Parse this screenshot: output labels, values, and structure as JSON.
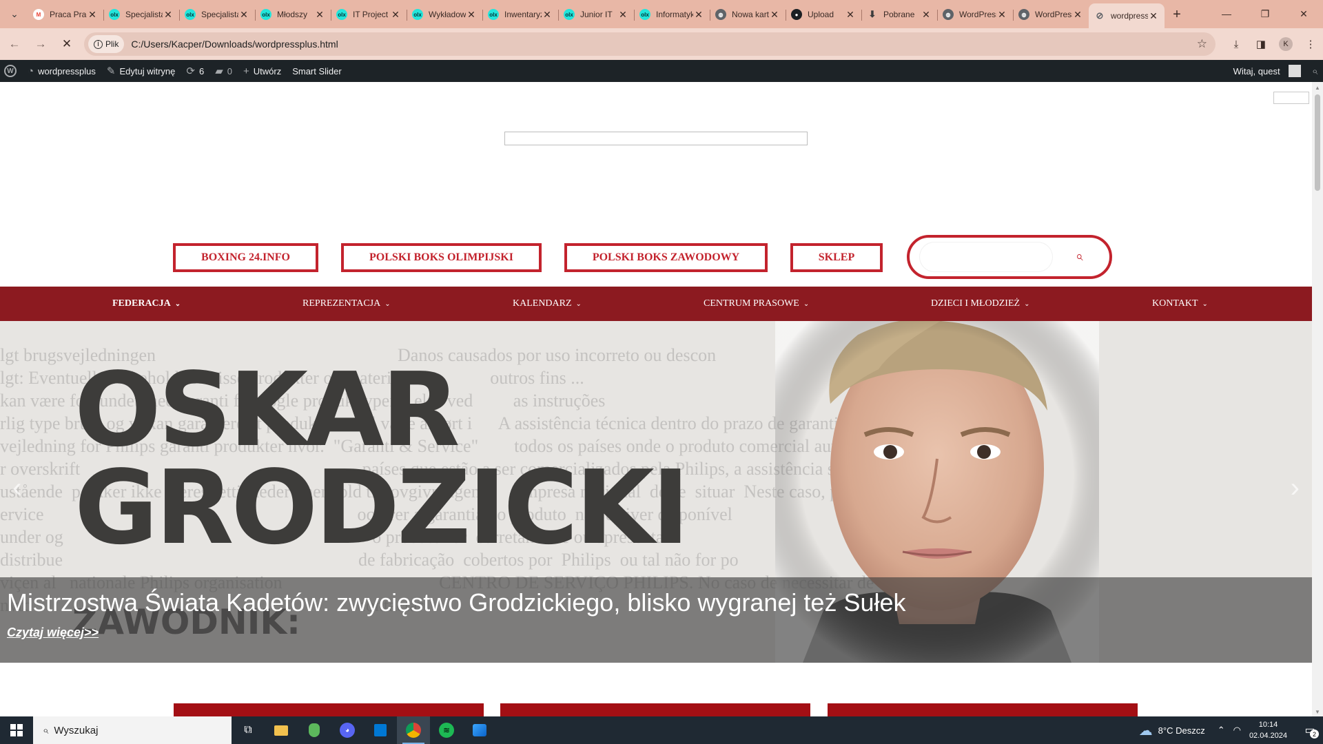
{
  "browser": {
    "tabs": [
      {
        "title": "Praca Pracuj.pl",
        "favicon": "gmail-icon",
        "color": "#ea4335"
      },
      {
        "title": "Specjalista",
        "favicon": "olx-icon",
        "color": "#23e5db"
      },
      {
        "title": "Specjalista",
        "favicon": "olx-icon",
        "color": "#23e5db"
      },
      {
        "title": "Młodszy",
        "favicon": "olx-icon",
        "color": "#23e5db"
      },
      {
        "title": "IT Project",
        "favicon": "olx-icon",
        "color": "#23e5db"
      },
      {
        "title": "Wykładowca",
        "favicon": "olx-icon",
        "color": "#23e5db"
      },
      {
        "title": "Inwentaryzacja",
        "favicon": "olx-icon",
        "color": "#23e5db"
      },
      {
        "title": "Junior IT",
        "favicon": "olx-icon",
        "color": "#23e5db"
      },
      {
        "title": "Informatyk",
        "favicon": "olx-icon",
        "color": "#23e5db"
      },
      {
        "title": "Nowa karta",
        "favicon": "globe-icon",
        "color": "#5f6368"
      },
      {
        "title": "Upload",
        "favicon": "github-icon",
        "color": "#1b1f23"
      },
      {
        "title": "Pobrane",
        "favicon": "download-icon",
        "color": "#3c3c3c"
      },
      {
        "title": "WordPress",
        "favicon": "globe-icon",
        "color": "#5f6368"
      },
      {
        "title": "WordPress",
        "favicon": "globe-icon",
        "color": "#5f6368"
      },
      {
        "title": "wordpressplus",
        "favicon": "page-icon",
        "color": "#5f6368",
        "active": true
      }
    ],
    "site_chip": "Plik",
    "url": "C:/Users/Kacper/Downloads/wordpressplus.html",
    "profile_initial": "K"
  },
  "adminbar": {
    "site_name": "wordpressplus",
    "edit_site": "Edytuj witrynę",
    "updates_count": "6",
    "comments_count": "0",
    "new_label": "Utwórz",
    "smart_slider": "Smart Slider",
    "greeting": "Witaj, quest"
  },
  "site": {
    "top_buttons": [
      "BOXING 24.INFO",
      "POLSKI BOKS OLIMPIJSKI",
      "POLSKI BOKS ZAWODOWY",
      "SKLEP"
    ],
    "nav": [
      "FEDERACJA",
      "REPREZENTACJA",
      "KALENDARZ",
      "CENTRUM PRASOWE",
      "DZIECI I MŁODZIEŻ",
      "KONTAKT"
    ],
    "slider": {
      "name_line1": "OSKAR",
      "name_line2": "GRODZICKI",
      "lower_text": "ZAWODNIK:",
      "title": "Mistrzostwa Świata Kadetów: zwycięstwo Grodzickiego, blisko wygranej też Sułek",
      "read_more": "Czytaj więcej>>"
    },
    "accent_color": "#c3232d",
    "nav_color": "#8c1a20"
  },
  "taskbar": {
    "search_placeholder": "Wyszukaj",
    "weather": "8°C  Deszcz",
    "time": "10:14",
    "date": "02.04.2024",
    "notifications": "2"
  }
}
